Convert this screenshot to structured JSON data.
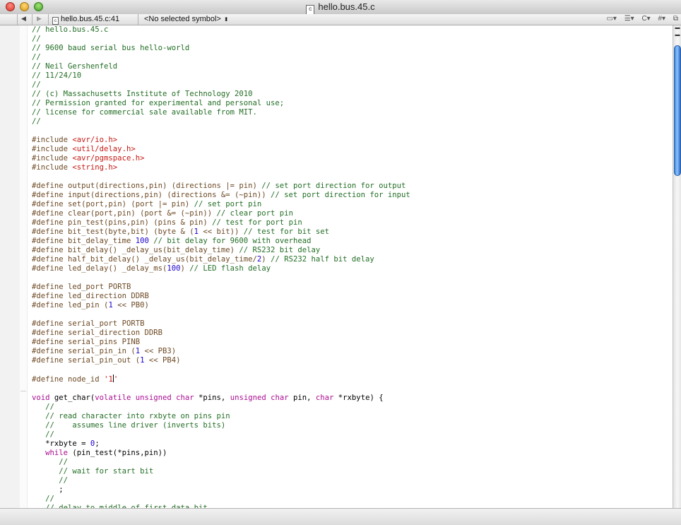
{
  "window": {
    "title": "hello.bus.45.c",
    "file_icon_letter": "c"
  },
  "navbar": {
    "back_arrow": "◀",
    "forward_arrow": "▶",
    "file_popup": "hello.bus.45.c:41",
    "symbol_popup": "<No selected symbol>",
    "updown": "⬍",
    "tool_icons": [
      "list-icon",
      "bookmarks-icon",
      "counterparts-icon",
      "includes-icon",
      "split-icon"
    ],
    "tool_glyphs": [
      "▭▾",
      "☰▾",
      "C▾",
      "#▾",
      "⧉"
    ]
  },
  "editor": {
    "current_line": 41,
    "code_lines": [
      "// hello.bus.45.c",
      "//",
      "// 9600 baud serial bus hello-world",
      "//",
      "// Neil Gershenfeld",
      "// 11/24/10",
      "//",
      "// (c) Massachusetts Institute of Technology 2010",
      "// Permission granted for experimental and personal use;",
      "// license for commercial sale available from MIT.",
      "//",
      "",
      "#include <avr/io.h>",
      "#include <util/delay.h>",
      "#include <avr/pgmspace.h>",
      "#include <string.h>",
      "",
      "#define output(directions,pin) (directions |= pin) // set port direction for output",
      "#define input(directions,pin) (directions &= (~pin)) // set port direction for input",
      "#define set(port,pin) (port |= pin) // set port pin",
      "#define clear(port,pin) (port &= (~pin)) // clear port pin",
      "#define pin_test(pins,pin) (pins & pin) // test for port pin",
      "#define bit_test(byte,bit) (byte & (1 << bit)) // test for bit set",
      "#define bit_delay_time 100 // bit delay for 9600 with overhead",
      "#define bit_delay() _delay_us(bit_delay_time) // RS232 bit delay",
      "#define half_bit_delay() _delay_us(bit_delay_time/2) // RS232 half bit delay",
      "#define led_delay() _delay_ms(100) // LED flash delay",
      "",
      "#define led_port PORTB",
      "#define led_direction DDRB",
      "#define led_pin (1 << PB0)",
      "",
      "#define serial_port PORTB",
      "#define serial_direction DDRB",
      "#define serial_pins PINB",
      "#define serial_pin_in (1 << PB3)",
      "#define serial_pin_out (1 << PB4)",
      "",
      "#define node_id '1'",
      "",
      "void get_char(volatile unsigned char *pins, unsigned char pin, char *rxbyte) {",
      "   //",
      "   // read character into rxbyte on pins pin",
      "   //    assumes line driver (inverts bits)",
      "   //",
      "   *rxbyte = 0;",
      "   while (pin_test(*pins,pin))",
      "      //",
      "      // wait for start bit",
      "      //",
      "      ;",
      "   //",
      "   // delay to middle of first data bit"
    ]
  },
  "colors": {
    "comment": "#236e25",
    "preprocessor": "#6d4a25",
    "string": "#c41a16",
    "keyword": "#aa0d91",
    "number": "#1c00cf",
    "scroll_thumb": "#3a86d9"
  }
}
